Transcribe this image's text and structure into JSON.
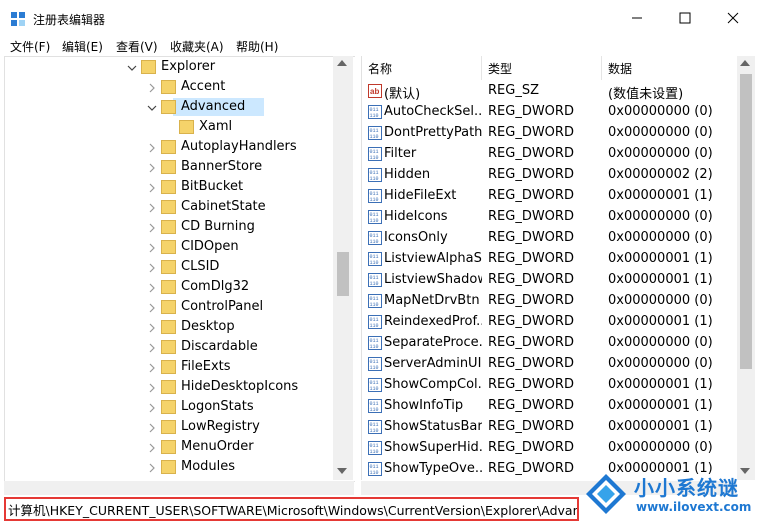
{
  "window": {
    "title": "注册表编辑器",
    "icon": "registry-editor-icon",
    "minimize_icon": "minimize-icon",
    "maximize_icon": "maximize-icon",
    "close_icon": "close-icon"
  },
  "menu": [
    {
      "label": "文件(F)"
    },
    {
      "label": "编辑(E)"
    },
    {
      "label": "查看(V)"
    },
    {
      "label": "收藏夹(A)"
    },
    {
      "label": "帮助(H)"
    }
  ],
  "tree": [
    {
      "label": "Explorer",
      "expanded": true,
      "level": 0
    },
    {
      "label": "Accent",
      "level": 1
    },
    {
      "label": "Advanced",
      "expanded": true,
      "selected": true,
      "level": 1
    },
    {
      "label": "Xaml",
      "level": 2
    },
    {
      "label": "AutoplayHandlers",
      "level": 1
    },
    {
      "label": "BannerStore",
      "level": 1
    },
    {
      "label": "BitBucket",
      "level": 1
    },
    {
      "label": "CabinetState",
      "level": 1
    },
    {
      "label": "CD Burning",
      "level": 1
    },
    {
      "label": "CIDOpen",
      "level": 1
    },
    {
      "label": "CLSID",
      "level": 1
    },
    {
      "label": "ComDlg32",
      "level": 1
    },
    {
      "label": "ControlPanel",
      "level": 1
    },
    {
      "label": "Desktop",
      "level": 1
    },
    {
      "label": "Discardable",
      "level": 1
    },
    {
      "label": "FileExts",
      "level": 1
    },
    {
      "label": "HideDesktopIcons",
      "level": 1
    },
    {
      "label": "LogonStats",
      "level": 1
    },
    {
      "label": "LowRegistry",
      "level": 1
    },
    {
      "label": "MenuOrder",
      "level": 1
    },
    {
      "label": "Modules",
      "level": 1
    }
  ],
  "list": {
    "headers": {
      "name": "名称",
      "type": "类型",
      "data": "数据"
    },
    "rows": [
      {
        "name": "(默认)",
        "type": "REG_SZ",
        "data": "(数值未设置)",
        "icon": "string-value-icon"
      },
      {
        "name": "AutoCheckSel...",
        "type": "REG_DWORD",
        "data": "0x00000000 (0)",
        "icon": "dword-value-icon"
      },
      {
        "name": "DontPrettyPath",
        "type": "REG_DWORD",
        "data": "0x00000000 (0)",
        "icon": "dword-value-icon"
      },
      {
        "name": "Filter",
        "type": "REG_DWORD",
        "data": "0x00000000 (0)",
        "icon": "dword-value-icon"
      },
      {
        "name": "Hidden",
        "type": "REG_DWORD",
        "data": "0x00000002 (2)",
        "icon": "dword-value-icon"
      },
      {
        "name": "HideFileExt",
        "type": "REG_DWORD",
        "data": "0x00000001 (1)",
        "icon": "dword-value-icon"
      },
      {
        "name": "HideIcons",
        "type": "REG_DWORD",
        "data": "0x00000000 (0)",
        "icon": "dword-value-icon"
      },
      {
        "name": "IconsOnly",
        "type": "REG_DWORD",
        "data": "0x00000000 (0)",
        "icon": "dword-value-icon"
      },
      {
        "name": "ListviewAlphaS...",
        "type": "REG_DWORD",
        "data": "0x00000001 (1)",
        "icon": "dword-value-icon"
      },
      {
        "name": "ListviewShadow",
        "type": "REG_DWORD",
        "data": "0x00000001 (1)",
        "icon": "dword-value-icon"
      },
      {
        "name": "MapNetDrvBtn",
        "type": "REG_DWORD",
        "data": "0x00000000 (0)",
        "icon": "dword-value-icon"
      },
      {
        "name": "ReindexedProf...",
        "type": "REG_DWORD",
        "data": "0x00000001 (1)",
        "icon": "dword-value-icon"
      },
      {
        "name": "SeparateProce...",
        "type": "REG_DWORD",
        "data": "0x00000000 (0)",
        "icon": "dword-value-icon"
      },
      {
        "name": "ServerAdminUI",
        "type": "REG_DWORD",
        "data": "0x00000000 (0)",
        "icon": "dword-value-icon"
      },
      {
        "name": "ShowCompCol...",
        "type": "REG_DWORD",
        "data": "0x00000001 (1)",
        "icon": "dword-value-icon"
      },
      {
        "name": "ShowInfoTip",
        "type": "REG_DWORD",
        "data": "0x00000001 (1)",
        "icon": "dword-value-icon"
      },
      {
        "name": "ShowStatusBar",
        "type": "REG_DWORD",
        "data": "0x00000001 (1)",
        "icon": "dword-value-icon"
      },
      {
        "name": "ShowSuperHid...",
        "type": "REG_DWORD",
        "data": "0x00000000 (0)",
        "icon": "dword-value-icon"
      },
      {
        "name": "ShowTypeOve...",
        "type": "REG_DWORD",
        "data": "0x00000001 (1)",
        "icon": "dword-value-icon"
      }
    ]
  },
  "statusbar": {
    "path": "计算机\\HKEY_CURRENT_USER\\SOFTWARE\\Microsoft\\Windows\\CurrentVersion\\Explorer\\Advanced"
  },
  "watermark": {
    "brand": "小小系统谜",
    "url": "www.ilovext.com",
    "logo_icon": "windows-logo-icon"
  },
  "colors": {
    "selection": "#cce8ff",
    "folder": "#f5d36a",
    "status_border": "#e53935",
    "watermark_blue": "#1e78d2"
  }
}
